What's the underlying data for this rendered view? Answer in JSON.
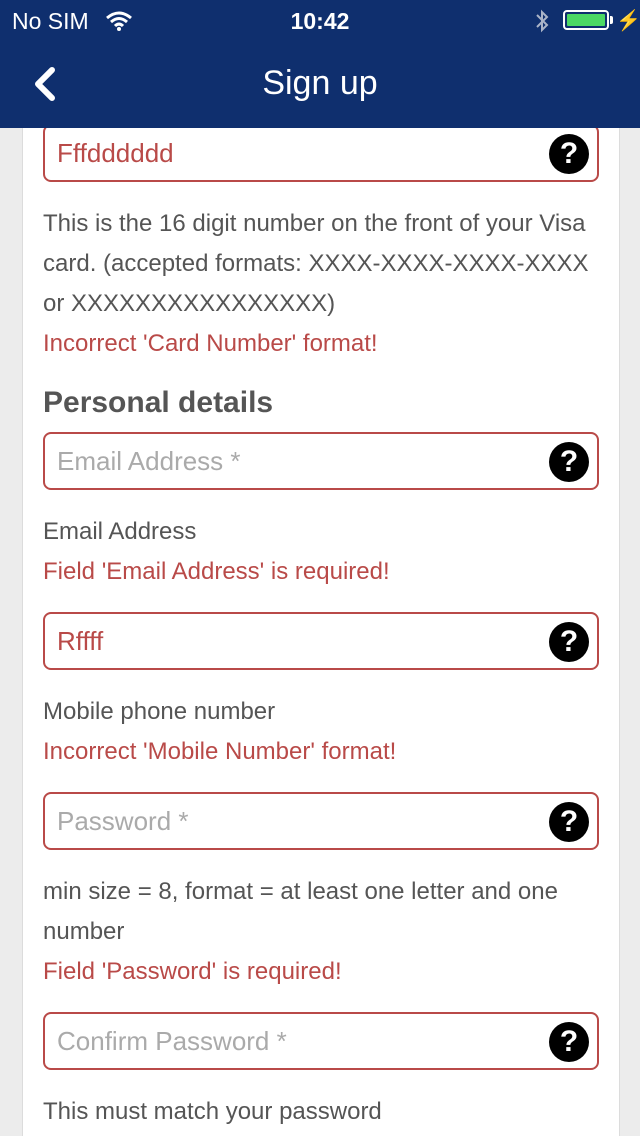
{
  "status_bar": {
    "carrier": "No SIM",
    "time": "10:42",
    "icons": [
      "wifi-icon",
      "bluetooth-icon",
      "battery-icon",
      "charging-icon"
    ]
  },
  "nav": {
    "title": "Sign up",
    "back_icon": "chevron-left-icon",
    "color": "#0f2f6e"
  },
  "form": {
    "card_number": {
      "value": "Fffdddddd",
      "hint": "This is the 16 digit number on the front of your Visa card. (accepted formats: XXXX-XXXX-XXXX-XXXX or XXXXXXXXXXXXXXXX)",
      "error": "Incorrect 'Card Number' format!"
    },
    "section_title": "Personal details",
    "email": {
      "placeholder": "Email Address *",
      "value": "",
      "hint": "Email Address",
      "error": "Field 'Email Address' is required!"
    },
    "mobile": {
      "value": "Rffff",
      "hint": "Mobile phone number",
      "error": "Incorrect 'Mobile Number' format!"
    },
    "password": {
      "placeholder": "Password *",
      "value": "",
      "hint": "min size = 8, format = at least one letter and one number",
      "error": "Field 'Password' is required!"
    },
    "confirm_password": {
      "placeholder": "Confirm Password *",
      "value": "",
      "hint": "This must match your password"
    },
    "help_label": "?",
    "error_color": "#b94a48"
  }
}
